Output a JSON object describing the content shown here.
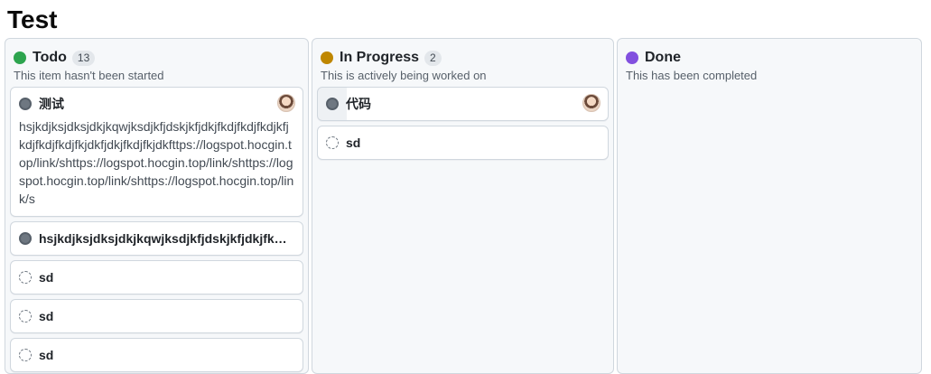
{
  "board": {
    "title": "Test"
  },
  "columns": [
    {
      "name": "Todo",
      "count": "13",
      "color": "#2da44e",
      "description": "This item hasn't been started",
      "cards": [
        {
          "title": "测试",
          "body": "hsjkdjksjdksjdkjkqwjksdjkfjdskjkfjdkjfkdjfkdjfkdjkfjkdjfkdjfkdjfkjdkfjdkjfkdjfkjdkfttps://logspot.hocgin.top/link/shttps://logspot.hocgin.top/link/shttps://logspot.hocgin.top/link/shttps://logspot.hocgin.top/link/s",
          "icon": "open-issue-icon",
          "has_avatar": true
        },
        {
          "title": "hsjkdjksjdksjdkjkqwjksdjkfjdskjkfjdkjfkdj...",
          "icon": "open-issue-icon"
        },
        {
          "title": "sd",
          "icon": "draft-issue-icon"
        },
        {
          "title": "sd",
          "icon": "draft-issue-icon"
        },
        {
          "title": "sd",
          "icon": "draft-issue-icon"
        }
      ]
    },
    {
      "name": "In Progress",
      "count": "2",
      "color": "#bf8700",
      "description": "This is actively being worked on",
      "cards": [
        {
          "title": "代码",
          "icon": "open-issue-icon",
          "has_avatar": true
        },
        {
          "title": "sd",
          "icon": "draft-issue-icon"
        }
      ]
    },
    {
      "name": "Done",
      "count": "",
      "color": "#8250df",
      "description": "This has been completed",
      "cards": []
    }
  ]
}
